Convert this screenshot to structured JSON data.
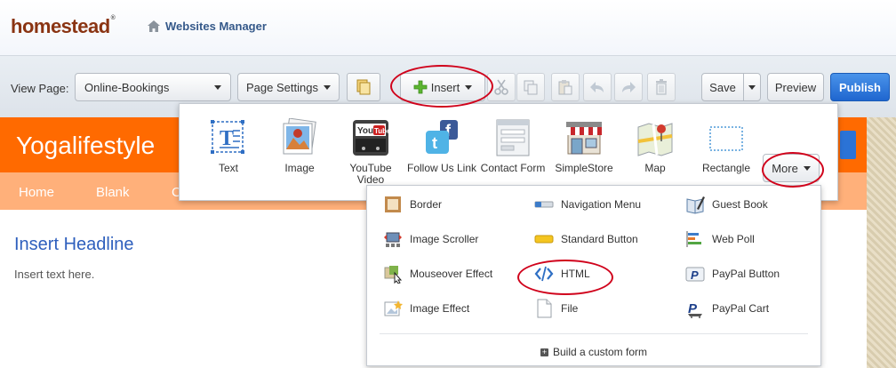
{
  "header": {
    "logo": "homestead",
    "logo_mark": "®",
    "websites_manager": "Websites Manager"
  },
  "toolbar": {
    "view_page_label": "View Page:",
    "page_select": "Online-Bookings",
    "page_settings": "Page Settings",
    "insert": "Insert",
    "save": "Save",
    "preview": "Preview",
    "publish": "Publish"
  },
  "site": {
    "title": "Yogalifestyle",
    "nav": [
      "Home",
      "Blank",
      "C"
    ],
    "headline": "Insert Headline",
    "body": "Insert text here."
  },
  "insert_panel": {
    "items": [
      {
        "label": "Text",
        "icon": "text-icon"
      },
      {
        "label": "Image",
        "icon": "image-icon"
      },
      {
        "label": "YouTube Video",
        "icon": "youtube-icon"
      },
      {
        "label": "Follow Us Link",
        "icon": "social-icon"
      },
      {
        "label": "Contact Form",
        "icon": "form-icon"
      },
      {
        "label": "SimpleStore",
        "icon": "store-icon"
      },
      {
        "label": "Map",
        "icon": "map-icon"
      },
      {
        "label": "Rectangle",
        "icon": "rectangle-icon"
      }
    ],
    "more": "More"
  },
  "more_panel": {
    "items": [
      {
        "label": "Border",
        "icon": "border-icon"
      },
      {
        "label": "Navigation Menu",
        "icon": "navigation-menu-icon"
      },
      {
        "label": "Guest Book",
        "icon": "guest-book-icon"
      },
      {
        "label": "Image Scroller",
        "icon": "image-scroller-icon"
      },
      {
        "label": "Standard Button",
        "icon": "standard-button-icon"
      },
      {
        "label": "Web Poll",
        "icon": "web-poll-icon"
      },
      {
        "label": "Mouseover Effect",
        "icon": "mouseover-effect-icon"
      },
      {
        "label": "HTML",
        "icon": "html-icon"
      },
      {
        "label": "PayPal Button",
        "icon": "paypal-button-icon"
      },
      {
        "label": "Image Effect",
        "icon": "image-effect-icon"
      },
      {
        "label": "File",
        "icon": "file-icon"
      },
      {
        "label": "PayPal Cart",
        "icon": "paypal-cart-icon"
      }
    ],
    "custom_form": "Build a custom form"
  },
  "colors": {
    "orange": "#ff6a00",
    "nav_orange": "#ffb07a",
    "publish_blue": "#2b73d6",
    "annotation_red": "#d0021b"
  }
}
